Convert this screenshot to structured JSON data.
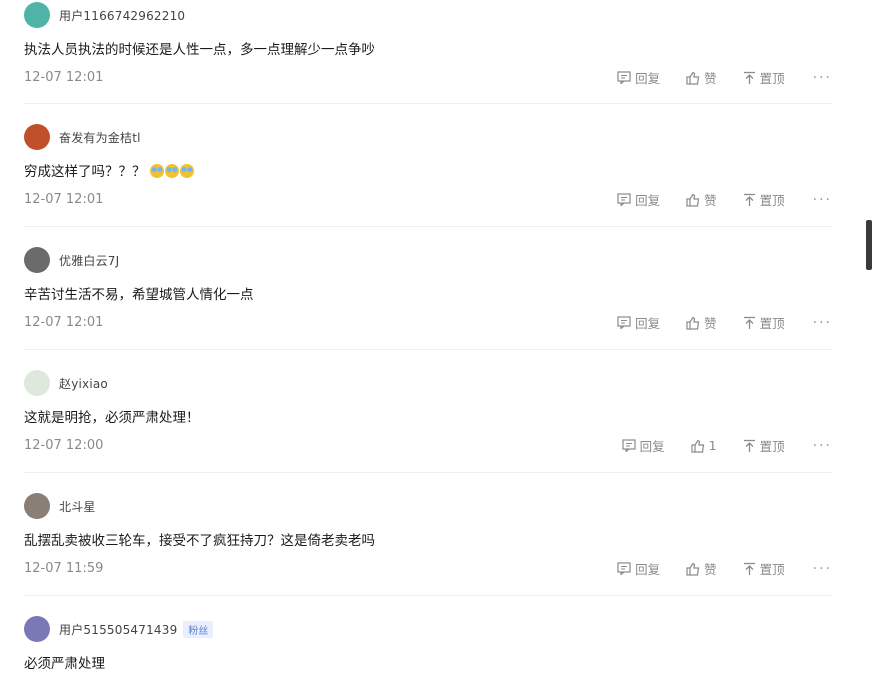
{
  "comments": [
    {
      "username": "用户1166742962210",
      "text": "执法人员执法的时候还是人性一点，多一点理解少一点争吵",
      "time": "12-07 12:01",
      "reply_label": "回复",
      "like_label": "赞",
      "pin_label": "置顶",
      "avatar_color": "#4fb3a8"
    },
    {
      "username": "奋发有为金桔tl",
      "text": "穷成这样了吗？？？",
      "emoji_count": 3,
      "time": "12-07 12:01",
      "reply_label": "回复",
      "like_label": "赞",
      "pin_label": "置顶",
      "avatar_color": "#c0502a"
    },
    {
      "username": "优雅白云7J",
      "text": "辛苦讨生活不易，希望城管人情化一点",
      "time": "12-07 12:01",
      "reply_label": "回复",
      "like_label": "赞",
      "pin_label": "置顶",
      "avatar_color": "#6b6b6b"
    },
    {
      "username": "赵yixiao",
      "text": "这就是明抢，必须严肃处理！",
      "time": "12-07 12:00",
      "reply_label": "回复",
      "like_label": "1",
      "pin_label": "置顶",
      "avatar_color": "#dfe8dc"
    },
    {
      "username": "北斗星",
      "text": "乱摆乱卖被收三轮车，接受不了疯狂持刀？这是倚老卖老吗",
      "time": "12-07 11:59",
      "reply_label": "回复",
      "like_label": "赞",
      "pin_label": "置顶",
      "avatar_color": "#8a7f77"
    },
    {
      "username": "用户515505471439",
      "badge": "粉丝",
      "text": "必须严肃处理",
      "avatar_color": "#7b78b8"
    }
  ],
  "more_label": "···",
  "colors": {
    "meta": "#8a8a8a",
    "divider": "#eeeeee",
    "badge": "#5a7fd6"
  }
}
